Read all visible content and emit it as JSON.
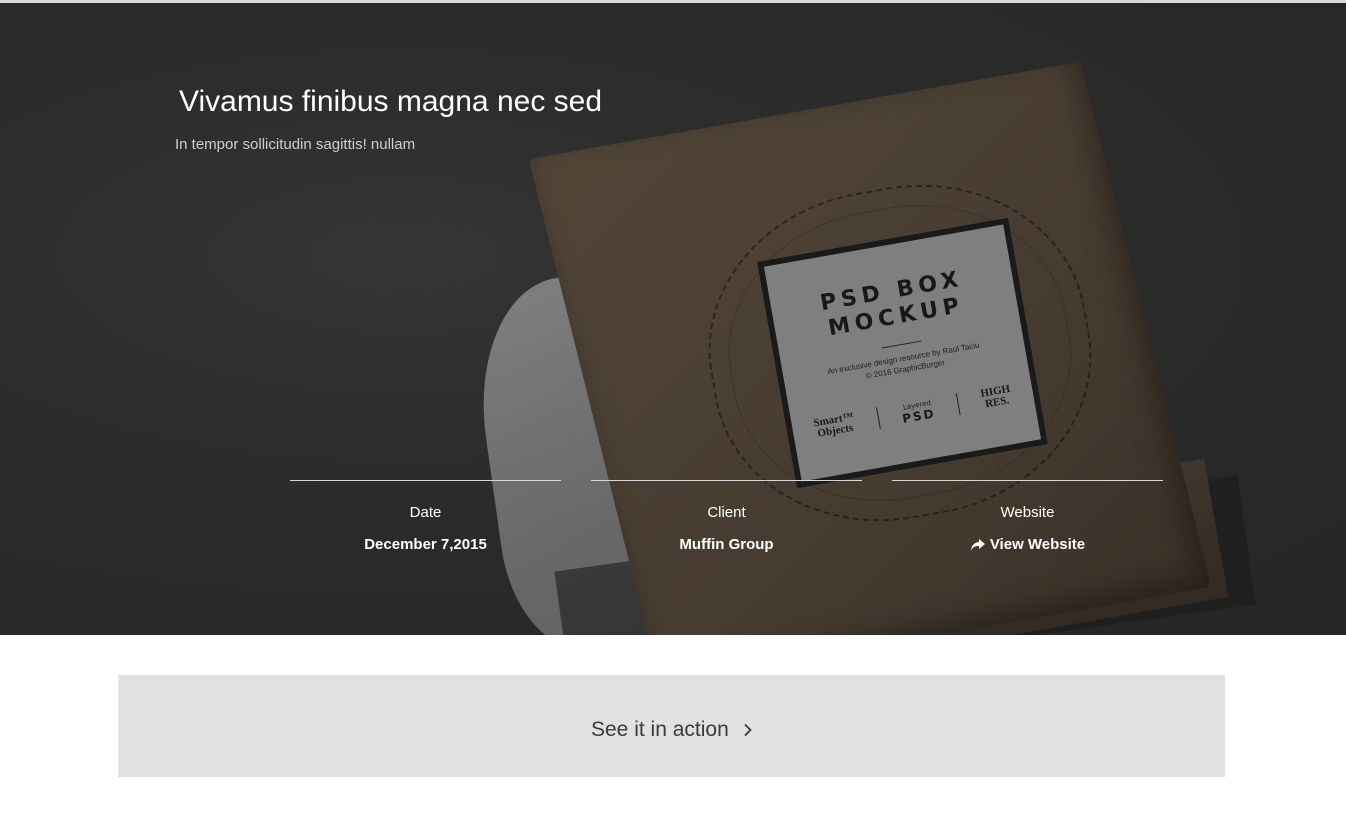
{
  "hero": {
    "title": "Vivamus finibus magna nec sed",
    "subtitle": "In tempor sollicitudin sagittis! nullam",
    "image": {
      "label_title_line1": "PSD BOX",
      "label_title_line2": "MOCKUP",
      "label_description_line1": "An exclusive design resource by Raul Taciu",
      "label_description_line2": "© 2016 GraphicBurger",
      "label_badge_smart_line1": "Smart™",
      "label_badge_smart_line2": "Objects",
      "label_badge_layered": "Layered",
      "label_badge_psd": "PSD",
      "label_badge_high_line1": "HIGH",
      "label_badge_high_line2": "RES."
    }
  },
  "project_meta": [
    {
      "label": "Date",
      "value": "December 7,2015"
    },
    {
      "label": "Client",
      "value": "Muffin Group"
    },
    {
      "label": "Website",
      "value": "View Website",
      "icon": "share-icon"
    }
  ],
  "action": {
    "label": "See it in action",
    "icon": "chevron-right-icon"
  },
  "colors": {
    "hero_background": "#2f2f2f",
    "panel_background": "#e1e1e1",
    "action_text": "#3a3a3a"
  }
}
